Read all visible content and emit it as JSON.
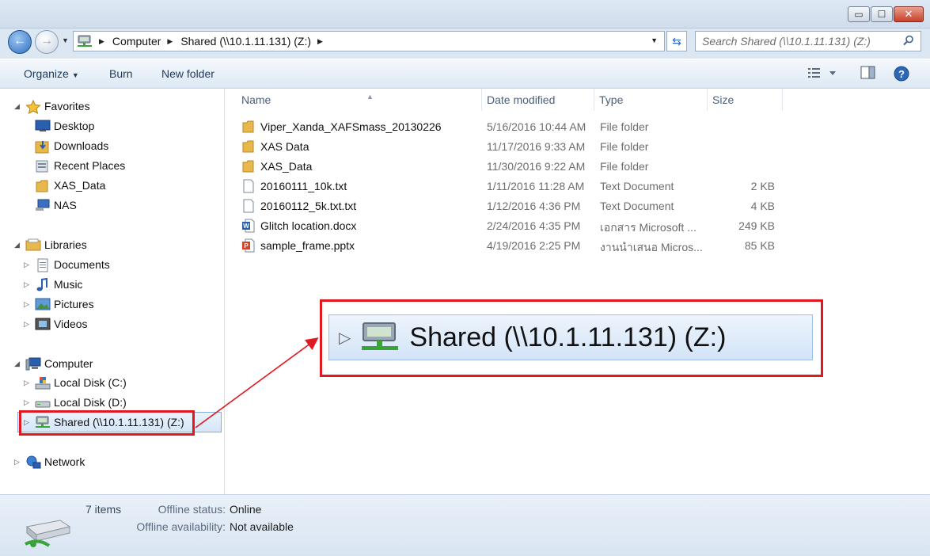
{
  "window": {
    "buttons": {
      "minimize": "▭",
      "maximize": "☐",
      "close": "✕"
    }
  },
  "address": {
    "crumbs": [
      "Computer",
      "Shared (\\\\10.1.11.131) (Z:)"
    ],
    "search_placeholder": "Search Shared (\\\\10.1.11.131) (Z:)"
  },
  "commandbar": {
    "organize": "Organize",
    "burn": "Burn",
    "new_folder": "New folder"
  },
  "nav": {
    "favorites": "Favorites",
    "desktop": "Desktop",
    "downloads": "Downloads",
    "recent_places": "Recent Places",
    "xas_data": "XAS_Data",
    "nas": "NAS",
    "libraries": "Libraries",
    "documents": "Documents",
    "music": "Music",
    "pictures": "Pictures",
    "videos": "Videos",
    "computer": "Computer",
    "local_c": "Local Disk (C:)",
    "local_d": "Local Disk (D:)",
    "shared_z": "Shared (\\\\10.1.11.131) (Z:)",
    "network": "Network"
  },
  "columns": {
    "name": "Name",
    "date": "Date modified",
    "type": "Type",
    "size": "Size"
  },
  "files": [
    {
      "icon": "folder-icon",
      "name": "Viper_Xanda_XAFSmass_20130226",
      "date": "5/16/2016 10:44 AM",
      "type": "File folder",
      "size": ""
    },
    {
      "icon": "folder-icon",
      "name": "XAS Data",
      "date": "11/17/2016 9:33 AM",
      "type": "File folder",
      "size": ""
    },
    {
      "icon": "folder-icon",
      "name": "XAS_Data",
      "date": "11/30/2016 9:22 AM",
      "type": "File folder",
      "size": ""
    },
    {
      "icon": "text-file-icon",
      "name": "20160111_10k.txt",
      "date": "1/11/2016 11:28 AM",
      "type": "Text Document",
      "size": "2 KB"
    },
    {
      "icon": "text-file-icon",
      "name": "20160112_5k.txt.txt",
      "date": "1/12/2016 4:36 PM",
      "type": "Text Document",
      "size": "4 KB"
    },
    {
      "icon": "word-file-icon",
      "name": "Glitch location.docx",
      "date": "2/24/2016 4:35 PM",
      "type": "เอกสาร Microsoft ...",
      "size": "249 KB"
    },
    {
      "icon": "powerpoint-file-icon",
      "name": "sample_frame.pptx",
      "date": "4/19/2016 2:25 PM",
      "type": "งานนำเสนอ Micros...",
      "size": "85 KB"
    }
  ],
  "status": {
    "item_count": "7 items",
    "offline_status_label": "Offline status:",
    "offline_status_value": "Online",
    "offline_availability_label": "Offline availability:",
    "offline_availability_value": "Not available"
  },
  "callout": {
    "text": "Shared (\\\\10.1.11.131) (Z:)"
  },
  "colors": {
    "highlight": "#e0181f",
    "selection": "#d5e6f8",
    "folder": "#e8b94a"
  }
}
